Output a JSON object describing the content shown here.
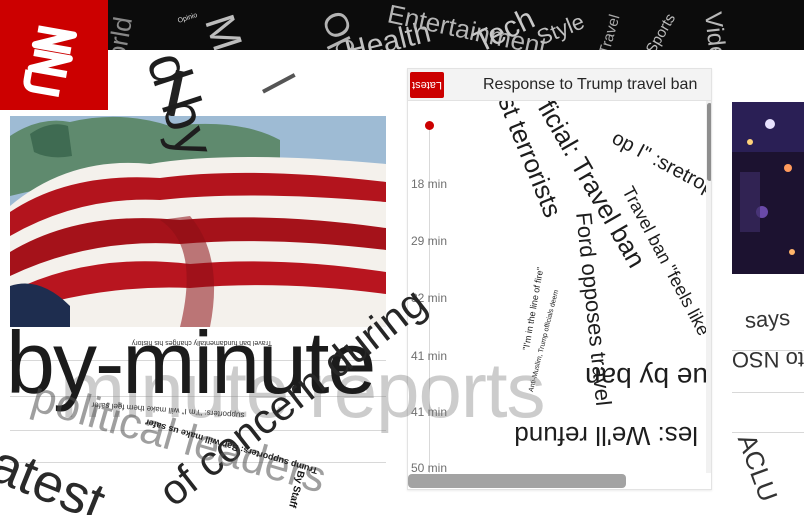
{
  "brand": {
    "logo_text": "CNN",
    "accent": "#cc0000"
  },
  "nav": {
    "items": [
      "World",
      "Money",
      "Opinion",
      "Health",
      "Entertainment",
      "Tech",
      "Style",
      "Travel",
      "Sports",
      "Video"
    ],
    "small_label": "Opinio"
  },
  "live_panel": {
    "badge": "Latest",
    "title": "Response to Trump travel ban",
    "timestamps": [
      "18 min",
      "29 min",
      "32 min",
      "41 min",
      "41 min",
      "50 min"
    ],
    "fragments": [
      "op I\" :sretroppus",
      "ficial: Travel ban",
      "st terrorists",
      "Ford opposes travel",
      "\"I'm in the line of fire\"",
      "Travel ban \"feels like\"",
      "ue by ban",
      "les: We'll refund",
      "Anti-Muslim, Trump officials deem",
      "Travel ban fundamentally changes his history",
      "supporters: \"op I\" says"
    ]
  },
  "overlay": {
    "headline_big": "by-minute",
    "headline_ghost": "minute reports",
    "rotated_words": [
      "latest",
      "of concern during",
      "political leaders",
      "d by"
    ],
    "small_lines": [
      "Travel ban fundamentally changes his history",
      "supporters: \"I'm I\" will make them feel safer",
      "Trump supporters: Ban will make us safer",
      "By Staff"
    ],
    "right_edge": [
      "says",
      "to NSO",
      "ACLU"
    ]
  }
}
